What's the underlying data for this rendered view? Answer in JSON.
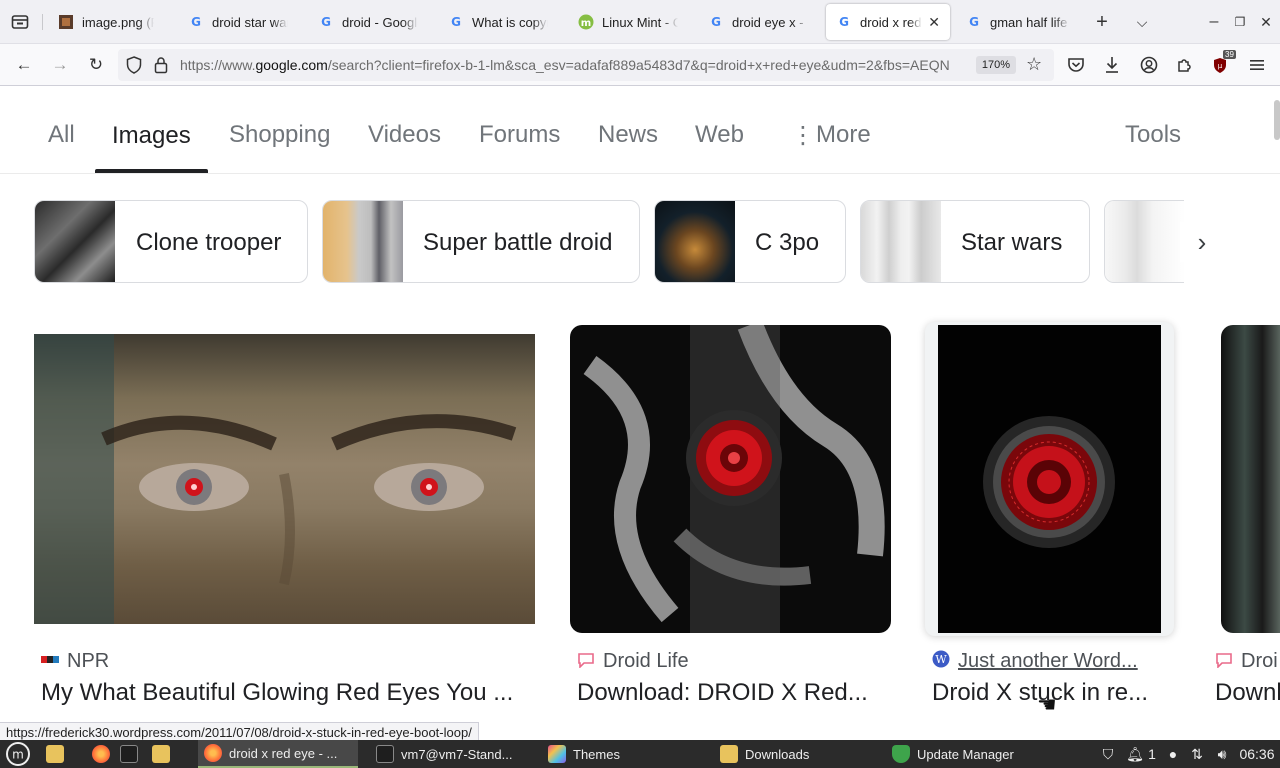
{
  "browser": {
    "tabs": [
      {
        "title": "image.png (Pi",
        "favicon": "image-file-icon"
      },
      {
        "title": "droid star war",
        "favicon": "google-icon"
      },
      {
        "title": "droid - Google",
        "favicon": "google-icon"
      },
      {
        "title": "What is copyr",
        "favicon": "google-icon"
      },
      {
        "title": "Linux Mint - C",
        "favicon": "linux-mint-icon"
      },
      {
        "title": "droid eye x - G",
        "favicon": "google-icon"
      },
      {
        "title": "droid x red",
        "favicon": "google-icon",
        "active": true
      },
      {
        "title": "gman half life",
        "favicon": "google-icon"
      }
    ],
    "url_prefix": "https://www.",
    "url_domain": "google.com",
    "url_rest": "/search?client=firefox-b-1-lm&sca_esv=adafaf889a5483d7&q=droid+x+red+eye&udm=2&fbs=AEQN",
    "zoom": "170%",
    "extension_badge": "39",
    "status_url": "https://frederick30.wordpress.com/2011/07/08/droid-x-stuck-in-red-eye-boot-loop/"
  },
  "search_tabs": {
    "all": "All",
    "images": "Images",
    "shopping": "Shopping",
    "videos": "Videos",
    "forums": "Forums",
    "news": "News",
    "web": "Web",
    "more": "More",
    "tools": "Tools"
  },
  "chips": [
    {
      "label": "Clone trooper"
    },
    {
      "label": "Super battle droid"
    },
    {
      "label": "C 3po"
    },
    {
      "label": "Star wars"
    }
  ],
  "results": [
    {
      "source": "NPR",
      "title": "My What Beautiful Glowing Red Eyes You ..."
    },
    {
      "source": "Droid Life",
      "title": "Download: DROID X Red..."
    },
    {
      "source": "Just another Word...",
      "title": "Droid X stuck in re..."
    },
    {
      "source": "Droi",
      "title": "Downl"
    }
  ],
  "taskbar": {
    "items": [
      {
        "label": "droid x red eye - ..."
      },
      {
        "label": "vm7@vm7-Stand..."
      },
      {
        "label": "Themes"
      },
      {
        "label": "Downloads"
      },
      {
        "label": "Update Manager"
      }
    ],
    "notif_count": "1",
    "clock": "06:36"
  },
  "colors": {
    "google_blue": "#4285f4",
    "tab_underline": "#202124",
    "eye_red": "#d0131b",
    "taskbar": "#2b2b2b"
  }
}
